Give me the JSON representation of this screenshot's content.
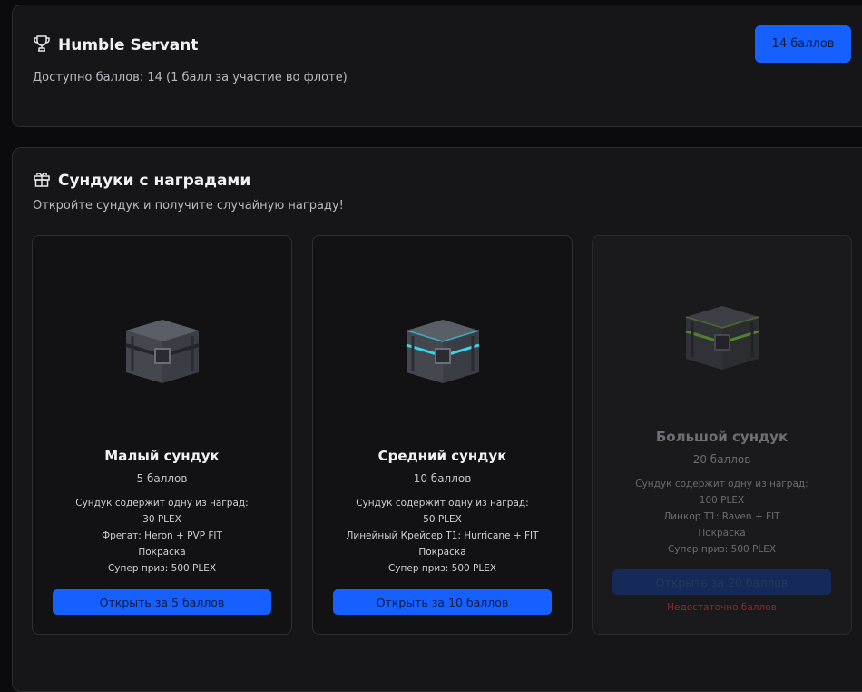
{
  "profile": {
    "name": "Humble Servant",
    "available": "Доступно баллов: 14 (1 балл за участие во флоте)",
    "points_badge": "14 баллов"
  },
  "chests_section": {
    "title": "Сундуки с наградами",
    "subtitle": "Откройте сундук и получите случайную награду!"
  },
  "chests": [
    {
      "name": "Малый сундук",
      "cost": "5 баллов",
      "contains": "Сундук содержит одну из наград:",
      "rewards": [
        "30 PLEX",
        "Фрегат: Heron + PVP FIT",
        "Покраска",
        "Супер приз: 500 PLEX"
      ],
      "button": "Открыть за 5 баллов",
      "glow": "#000000"
    },
    {
      "name": "Средний сундук",
      "cost": "10 баллов",
      "contains": "Сундук содержит одну из наград:",
      "rewards": [
        "50 PLEX",
        "Линейный Крейсер T1: Hurricane + FIT",
        "Покраска",
        "Супер приз: 500 PLEX"
      ],
      "button": "Открыть за 10 баллов",
      "glow": "#35d6ee"
    },
    {
      "name": "Большой сундук",
      "cost": "20 баллов",
      "contains": "Сундук содержит одну из наград:",
      "rewards": [
        "100 PLEX",
        "Линкор T1: Raven + FIT",
        "Покраска",
        "Супер приз: 500 PLEX"
      ],
      "button": "Открыть за 20 баллов",
      "warning": "Недостаточно баллов",
      "glow": "#7fd83a"
    }
  ]
}
